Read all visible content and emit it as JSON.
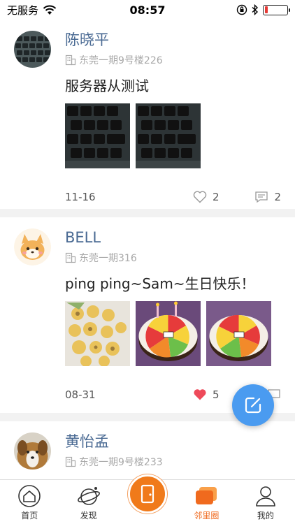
{
  "status_bar": {
    "carrier": "无服务",
    "time": "08:57",
    "battery_level": 0.15
  },
  "posts": [
    {
      "author": "陈晓平",
      "address": "东莞一期9号楼226",
      "text": "服务器从测试",
      "date": "11-16",
      "likes": "2",
      "comments": "2",
      "liked": false
    },
    {
      "author": "BELL",
      "address": "东莞一期316",
      "text": "ping ping~Sam~生日快乐！",
      "date": "08-31",
      "likes": "5",
      "comments": "",
      "liked": true
    },
    {
      "author": "黄怡孟",
      "address": "东莞一期9号楼233"
    }
  ],
  "tabs": [
    {
      "label": "首页",
      "icon": "home-icon"
    },
    {
      "label": "发现",
      "icon": "planet-icon"
    },
    {
      "label": "",
      "icon": "door-icon"
    },
    {
      "label": "邻里圈",
      "icon": "chat-cards-icon",
      "active": true
    },
    {
      "label": "我的",
      "icon": "person-icon"
    }
  ],
  "colors": {
    "author": "#4a6a93",
    "accent": "#f06a1e",
    "like_active": "#ee4a5a",
    "fab": "#4a9bf0"
  }
}
